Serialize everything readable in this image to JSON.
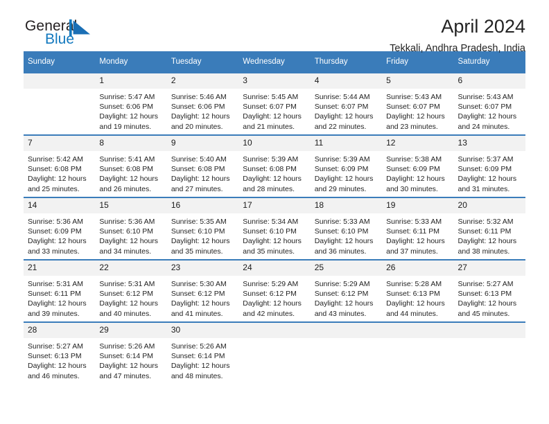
{
  "logo": {
    "text_primary": "General",
    "text_secondary": "Blue",
    "mark_name": "blue-flag-triangle-icon",
    "color_primary": "#231f20",
    "color_secondary": "#1278be"
  },
  "header": {
    "title": "April 2024",
    "subtitle": "Tekkali, Andhra Pradesh, India"
  },
  "theme": {
    "header_blue": "#3a7cba",
    "daynum_band": "#f2f2f2",
    "text": "#1a1a1a"
  },
  "weekday_headers": [
    "Sunday",
    "Monday",
    "Tuesday",
    "Wednesday",
    "Thursday",
    "Friday",
    "Saturday"
  ],
  "weeks": [
    [
      {
        "day": "",
        "lines": []
      },
      {
        "day": "1",
        "lines": [
          "Sunrise: 5:47 AM",
          "Sunset: 6:06 PM",
          "Daylight: 12 hours",
          "and 19 minutes."
        ]
      },
      {
        "day": "2",
        "lines": [
          "Sunrise: 5:46 AM",
          "Sunset: 6:06 PM",
          "Daylight: 12 hours",
          "and 20 minutes."
        ]
      },
      {
        "day": "3",
        "lines": [
          "Sunrise: 5:45 AM",
          "Sunset: 6:07 PM",
          "Daylight: 12 hours",
          "and 21 minutes."
        ]
      },
      {
        "day": "4",
        "lines": [
          "Sunrise: 5:44 AM",
          "Sunset: 6:07 PM",
          "Daylight: 12 hours",
          "and 22 minutes."
        ]
      },
      {
        "day": "5",
        "lines": [
          "Sunrise: 5:43 AM",
          "Sunset: 6:07 PM",
          "Daylight: 12 hours",
          "and 23 minutes."
        ]
      },
      {
        "day": "6",
        "lines": [
          "Sunrise: 5:43 AM",
          "Sunset: 6:07 PM",
          "Daylight: 12 hours",
          "and 24 minutes."
        ]
      }
    ],
    [
      {
        "day": "7",
        "lines": [
          "Sunrise: 5:42 AM",
          "Sunset: 6:08 PM",
          "Daylight: 12 hours",
          "and 25 minutes."
        ]
      },
      {
        "day": "8",
        "lines": [
          "Sunrise: 5:41 AM",
          "Sunset: 6:08 PM",
          "Daylight: 12 hours",
          "and 26 minutes."
        ]
      },
      {
        "day": "9",
        "lines": [
          "Sunrise: 5:40 AM",
          "Sunset: 6:08 PM",
          "Daylight: 12 hours",
          "and 27 minutes."
        ]
      },
      {
        "day": "10",
        "lines": [
          "Sunrise: 5:39 AM",
          "Sunset: 6:08 PM",
          "Daylight: 12 hours",
          "and 28 minutes."
        ]
      },
      {
        "day": "11",
        "lines": [
          "Sunrise: 5:39 AM",
          "Sunset: 6:09 PM",
          "Daylight: 12 hours",
          "and 29 minutes."
        ]
      },
      {
        "day": "12",
        "lines": [
          "Sunrise: 5:38 AM",
          "Sunset: 6:09 PM",
          "Daylight: 12 hours",
          "and 30 minutes."
        ]
      },
      {
        "day": "13",
        "lines": [
          "Sunrise: 5:37 AM",
          "Sunset: 6:09 PM",
          "Daylight: 12 hours",
          "and 31 minutes."
        ]
      }
    ],
    [
      {
        "day": "14",
        "lines": [
          "Sunrise: 5:36 AM",
          "Sunset: 6:09 PM",
          "Daylight: 12 hours",
          "and 33 minutes."
        ]
      },
      {
        "day": "15",
        "lines": [
          "Sunrise: 5:36 AM",
          "Sunset: 6:10 PM",
          "Daylight: 12 hours",
          "and 34 minutes."
        ]
      },
      {
        "day": "16",
        "lines": [
          "Sunrise: 5:35 AM",
          "Sunset: 6:10 PM",
          "Daylight: 12 hours",
          "and 35 minutes."
        ]
      },
      {
        "day": "17",
        "lines": [
          "Sunrise: 5:34 AM",
          "Sunset: 6:10 PM",
          "Daylight: 12 hours",
          "and 35 minutes."
        ]
      },
      {
        "day": "18",
        "lines": [
          "Sunrise: 5:33 AM",
          "Sunset: 6:10 PM",
          "Daylight: 12 hours",
          "and 36 minutes."
        ]
      },
      {
        "day": "19",
        "lines": [
          "Sunrise: 5:33 AM",
          "Sunset: 6:11 PM",
          "Daylight: 12 hours",
          "and 37 minutes."
        ]
      },
      {
        "day": "20",
        "lines": [
          "Sunrise: 5:32 AM",
          "Sunset: 6:11 PM",
          "Daylight: 12 hours",
          "and 38 minutes."
        ]
      }
    ],
    [
      {
        "day": "21",
        "lines": [
          "Sunrise: 5:31 AM",
          "Sunset: 6:11 PM",
          "Daylight: 12 hours",
          "and 39 minutes."
        ]
      },
      {
        "day": "22",
        "lines": [
          "Sunrise: 5:31 AM",
          "Sunset: 6:12 PM",
          "Daylight: 12 hours",
          "and 40 minutes."
        ]
      },
      {
        "day": "23",
        "lines": [
          "Sunrise: 5:30 AM",
          "Sunset: 6:12 PM",
          "Daylight: 12 hours",
          "and 41 minutes."
        ]
      },
      {
        "day": "24",
        "lines": [
          "Sunrise: 5:29 AM",
          "Sunset: 6:12 PM",
          "Daylight: 12 hours",
          "and 42 minutes."
        ]
      },
      {
        "day": "25",
        "lines": [
          "Sunrise: 5:29 AM",
          "Sunset: 6:12 PM",
          "Daylight: 12 hours",
          "and 43 minutes."
        ]
      },
      {
        "day": "26",
        "lines": [
          "Sunrise: 5:28 AM",
          "Sunset: 6:13 PM",
          "Daylight: 12 hours",
          "and 44 minutes."
        ]
      },
      {
        "day": "27",
        "lines": [
          "Sunrise: 5:27 AM",
          "Sunset: 6:13 PM",
          "Daylight: 12 hours",
          "and 45 minutes."
        ]
      }
    ],
    [
      {
        "day": "28",
        "lines": [
          "Sunrise: 5:27 AM",
          "Sunset: 6:13 PM",
          "Daylight: 12 hours",
          "and 46 minutes."
        ]
      },
      {
        "day": "29",
        "lines": [
          "Sunrise: 5:26 AM",
          "Sunset: 6:14 PM",
          "Daylight: 12 hours",
          "and 47 minutes."
        ]
      },
      {
        "day": "30",
        "lines": [
          "Sunrise: 5:26 AM",
          "Sunset: 6:14 PM",
          "Daylight: 12 hours",
          "and 48 minutes."
        ]
      },
      {
        "day": "",
        "lines": []
      },
      {
        "day": "",
        "lines": []
      },
      {
        "day": "",
        "lines": []
      },
      {
        "day": "",
        "lines": []
      }
    ]
  ]
}
